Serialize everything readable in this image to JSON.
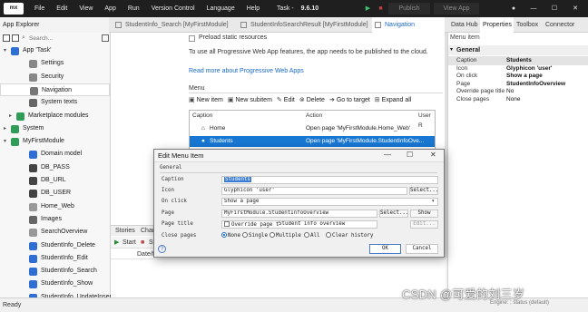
{
  "titlebar": {
    "logo": "mx",
    "menus": [
      "File",
      "Edit",
      "View",
      "App",
      "Run",
      "Version Control",
      "Language",
      "Help"
    ],
    "app_title": "Task",
    "version": "9.6.10",
    "publish_label": "Publish",
    "view_app_label": "View App",
    "min": "—",
    "max": "☐",
    "close": "✕"
  },
  "tabs": {
    "explorer": "App Explorer",
    "doc_tabs": [
      "StudentInfo_Search [MyFirstModule]",
      "StudentInfoSearchResult [MyFirstModule]",
      "Navigation"
    ],
    "right_tabs": [
      "Data Hub",
      "Properties",
      "Toolbox",
      "Connector"
    ]
  },
  "explorer": {
    "search_placeholder": "Search...",
    "items": [
      {
        "label": "App 'Task'",
        "level": 0,
        "arrow": "▾",
        "color": "#2f6fd3"
      },
      {
        "label": "Settings",
        "level": 2,
        "arrow": "",
        "color": "#888888"
      },
      {
        "label": "Security",
        "level": 2,
        "arrow": "",
        "color": "#888888"
      },
      {
        "label": "Navigation",
        "level": 2,
        "arrow": "",
        "color": "#777777"
      },
      {
        "label": "System texts",
        "level": 2,
        "arrow": "",
        "color": "#666666"
      },
      {
        "label": "Marketplace modules",
        "level": 1,
        "arrow": "▸",
        "color": "#2f9d57"
      },
      {
        "label": "System",
        "level": 0,
        "arrow": "▸",
        "color": "#2f9d57"
      },
      {
        "label": "MyFirstModule",
        "level": 0,
        "arrow": "▾",
        "color": "#2f9d57"
      },
      {
        "label": "Domain model",
        "level": 2,
        "arrow": "",
        "color": "#2f6fd3"
      },
      {
        "label": "DB_PASS",
        "level": 2,
        "arrow": "",
        "color": "#444444"
      },
      {
        "label": "DB_URL",
        "level": 2,
        "arrow": "",
        "color": "#444444"
      },
      {
        "label": "DB_USER",
        "level": 2,
        "arrow": "",
        "color": "#444444"
      },
      {
        "label": "Home_Web",
        "level": 2,
        "arrow": "",
        "color": "#999999"
      },
      {
        "label": "Images",
        "level": 2,
        "arrow": "",
        "color": "#666666"
      },
      {
        "label": "SearchOverview",
        "level": 2,
        "arrow": "",
        "color": "#999999"
      },
      {
        "label": "StudentInfo_Delete",
        "level": 2,
        "arrow": "",
        "color": "#2f6fd3"
      },
      {
        "label": "StudentInfo_Edit",
        "level": 2,
        "arrow": "",
        "color": "#2f6fd3"
      },
      {
        "label": "StudentInfo_Search",
        "level": 2,
        "arrow": "",
        "color": "#2f6fd3"
      },
      {
        "label": "StudentInfo_Show",
        "level": 2,
        "arrow": "",
        "color": "#2f6fd3"
      },
      {
        "label": "StudentInfo_UpdateInsert",
        "level": 2,
        "arrow": "",
        "color": "#2f6fd3"
      }
    ]
  },
  "doc": {
    "preload_label": "Preload static resources",
    "pwa_notice": "To use all Progressive Web App features, the app needs to be published to the cloud.",
    "pwa_link": "Read more about Progressive Web Apps",
    "menu_section": "Menu",
    "toolbar": [
      "New item",
      "New subitem",
      "Edit",
      "Delete",
      "Go to target",
      "Expand all"
    ],
    "table_headers": [
      "Caption",
      "Action",
      "User R"
    ],
    "rows": [
      {
        "caption": "Home",
        "action": "Open page 'MyFirstModule.Home_Web'"
      },
      {
        "caption": "Students",
        "action": "Open page 'MyFirstModule.StudentInfoOve..."
      }
    ],
    "bottom_tabs": [
      "Stories",
      "Chan"
    ],
    "start_label": "Start",
    "stop_label": "Stop",
    "date_header": "Date/ti"
  },
  "properties": {
    "title": "Menu item",
    "section": "General",
    "rows": [
      {
        "key": "Caption",
        "value": "Students",
        "bold": true
      },
      {
        "key": "Icon",
        "value": "Glyphicon 'user'",
        "bold": true
      },
      {
        "key": "On click",
        "value": "Show a page",
        "bold": true
      },
      {
        "key": "Page",
        "value": "StudentInfoOverview",
        "bold": true
      },
      {
        "key": "Override page title",
        "value": "No",
        "bold": false
      },
      {
        "key": "Close pages",
        "value": "None",
        "bold": false
      }
    ]
  },
  "dialog": {
    "title": "Edit Menu Item",
    "section": "General",
    "caption_label": "Caption",
    "caption_value": "Students",
    "icon_label": "Icon",
    "icon_value": "Glyphicon 'user'",
    "select_btn": "Select...",
    "onclick_label": "On click",
    "onclick_value": "Show a page",
    "page_label": "Page",
    "page_value": "MyFirstModule.StudentInfoOverview",
    "page_select_btn": "Select...",
    "show_btn": "Show",
    "page_title_label": "Page title",
    "override_label": "Override page t",
    "page_title_value": "Student info overview",
    "edit_btn": "Edit...",
    "close_pages_label": "Close pages",
    "close_options": [
      "None",
      "Single",
      "Multiple",
      "All",
      "Clear history"
    ],
    "selected_option": "None",
    "ok": "OK",
    "cancel": "Cancel"
  },
  "statusbar": {
    "text": "Ready",
    "right": "Engine: ; status (default)"
  },
  "watermark": "CSDN @可爱的刘三岁",
  "colors": {
    "accent": "#1877d2",
    "titlebar": "#1f1f1f"
  }
}
